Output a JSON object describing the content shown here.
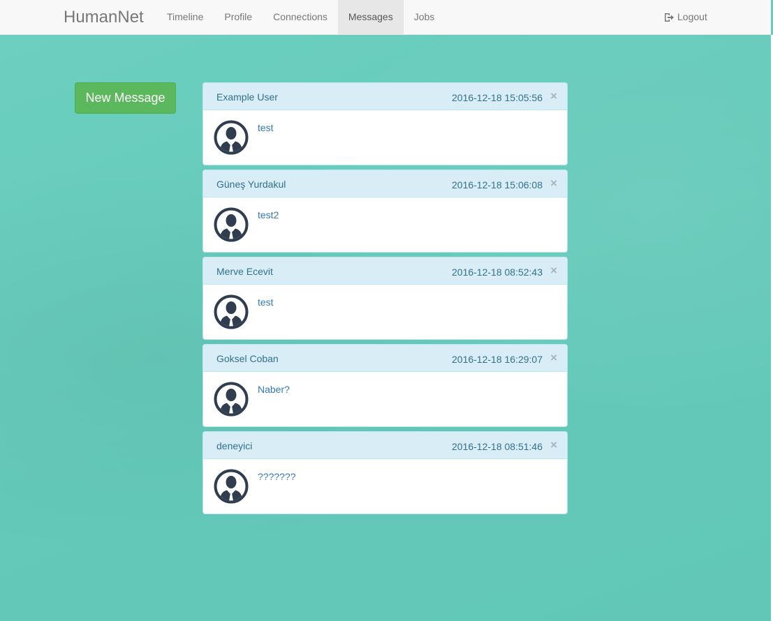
{
  "navbar": {
    "brand": "HumanNet",
    "items": [
      {
        "label": "Timeline",
        "active": false
      },
      {
        "label": "Profile",
        "active": false
      },
      {
        "label": "Connections",
        "active": false
      },
      {
        "label": "Messages",
        "active": true
      },
      {
        "label": "Jobs",
        "active": false
      }
    ],
    "logout_label": "Logout",
    "logout_icon": "logout-icon"
  },
  "actions": {
    "new_message_label": "New Message"
  },
  "messages": [
    {
      "sender": "Example User",
      "timestamp": "2016-12-18 15:05:56",
      "text": "test",
      "close": "×"
    },
    {
      "sender": "Güneş Yurdakul",
      "timestamp": "2016-12-18 15:06:08",
      "text": "test2",
      "close": "×"
    },
    {
      "sender": "Merve Ecevit",
      "timestamp": "2016-12-18 08:52:43",
      "text": "test",
      "close": "×"
    },
    {
      "sender": "Goksel Coban",
      "timestamp": "2016-12-18 16:29:07",
      "text": "Naber?",
      "close": "×"
    },
    {
      "sender": "deneyici",
      "timestamp": "2016-12-18 08:51:46",
      "text": "???????",
      "close": "×"
    }
  ],
  "colors": {
    "background": "#66cbbb",
    "navbar": "#f8f8f8",
    "button_success": "#5cb85c",
    "panel_heading": "#d9edf7",
    "panel_text": "#31708f",
    "link": "#337ab7",
    "avatar": "#2f3d4f"
  }
}
